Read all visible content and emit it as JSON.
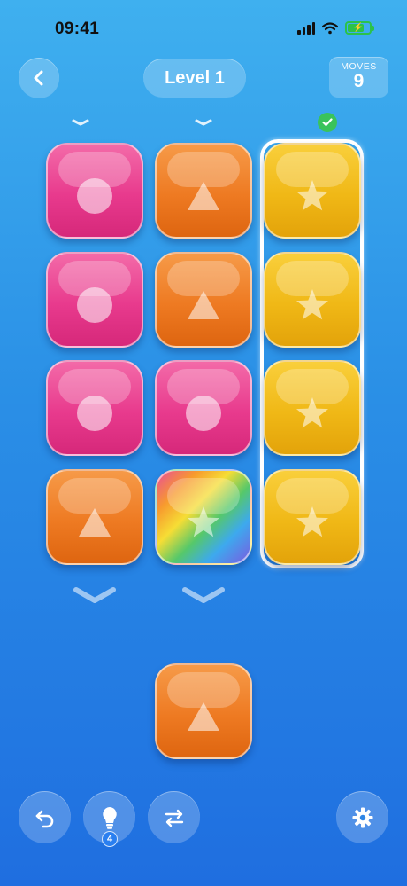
{
  "status_bar": {
    "time": "09:41"
  },
  "header": {
    "level_title": "Level 1",
    "moves_label": "MOVES",
    "moves_value": "9"
  },
  "board": {
    "columns": [
      {
        "state": "open",
        "tiles": [
          {
            "color": "pink",
            "symbol": "circle"
          },
          {
            "color": "pink",
            "symbol": "circle"
          },
          {
            "color": "pink",
            "symbol": "circle"
          },
          {
            "color": "orange",
            "symbol": "triangle"
          }
        ]
      },
      {
        "state": "open",
        "tiles": [
          {
            "color": "orange",
            "symbol": "triangle"
          },
          {
            "color": "orange",
            "symbol": "triangle"
          },
          {
            "color": "pink",
            "symbol": "circle"
          },
          {
            "color": "rainbow",
            "symbol": "star"
          }
        ]
      },
      {
        "state": "solved",
        "tiles": [
          {
            "color": "yellow",
            "symbol": "star"
          },
          {
            "color": "yellow",
            "symbol": "star"
          },
          {
            "color": "yellow",
            "symbol": "star"
          },
          {
            "color": "yellow",
            "symbol": "star"
          }
        ]
      }
    ],
    "held_tile": {
      "color": "orange",
      "symbol": "triangle"
    }
  },
  "toolbar": {
    "undo_icon": "undo-arrow-icon",
    "hint_icon": "lightbulb-icon",
    "hint_count": "4",
    "swap_icon": "swap-arrows-icon",
    "settings_icon": "gear-icon"
  },
  "colors": {
    "background_top": "#3fb0ef",
    "background_bottom": "#1f6ee0",
    "pink": "#e83a8d",
    "orange": "#ee7a22",
    "yellow": "#f0b816",
    "solved_check": "#3ac35b"
  }
}
